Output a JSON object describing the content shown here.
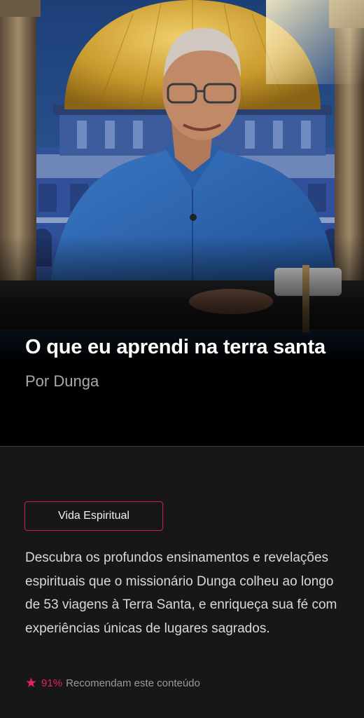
{
  "hero": {
    "title": "O que eu aprendi na terra santa",
    "author": "Por Dunga",
    "image_alt": "Photo of a man in a blue shirt in front of the Dome of the Rock"
  },
  "details": {
    "category_tag": "Vida Espiritual",
    "description": "Descubra os profundos ensinamentos e revelações espirituais que o missionário Dunga colheu ao longo de 53 viagens à Terra Santa, e enriqueça sua fé com experiências únicas de lugares sagrados.",
    "recommendation": {
      "icon": "star-icon",
      "percent": "91%",
      "label": "Recomendam este conteúdo"
    }
  },
  "colors": {
    "accent": "#e3245a",
    "panel_bg": "#171717",
    "page_bg": "#000000"
  }
}
